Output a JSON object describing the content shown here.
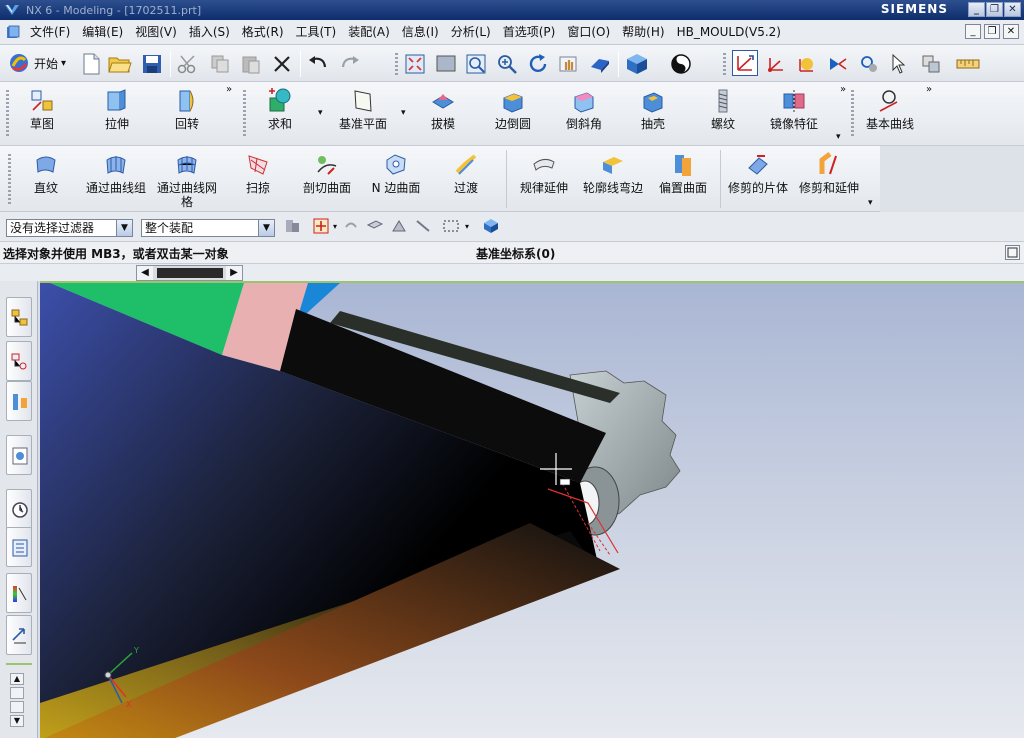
{
  "window": {
    "title": "NX 6 - Modeling - [1702511.prt]",
    "brand": "SIEMENS",
    "controls": [
      "_",
      "❐",
      "✕"
    ]
  },
  "menubar": {
    "items": [
      "文件(F)",
      "编辑(E)",
      "视图(V)",
      "插入(S)",
      "格式(R)",
      "工具(T)",
      "装配(A)",
      "信息(I)",
      "分析(L)",
      "首选项(P)",
      "窗口(O)",
      "帮助(H)",
      "HB_MOULD(V5.2)"
    ],
    "mdi_controls": [
      "_",
      "❐",
      "✕"
    ]
  },
  "standard_toolbar": {
    "start_label": "开始",
    "start_arrow": "▾"
  },
  "feature_toolbar": {
    "items": [
      "草图",
      "拉伸",
      "回转",
      "求和",
      "基准平面",
      "拔模",
      "边倒圆",
      "倒斜角",
      "抽壳",
      "螺纹",
      "镜像特征",
      "基本曲线"
    ],
    "overflow": "»"
  },
  "surface_toolbar": {
    "items": [
      "直纹",
      "通过曲线组",
      "通过曲线网格",
      "扫掠",
      "剖切曲面",
      "N 边曲面",
      "过渡",
      "规律延伸",
      "轮廓线弯边",
      "偏置曲面",
      "修剪的片体",
      "修剪和延伸"
    ]
  },
  "selection_bar": {
    "filter_value": "没有选择过滤器",
    "scope_value": "整个装配"
  },
  "status": {
    "cue": "选择对象并使用 MB3，或者双击某一对象",
    "status_text": "基准坐标系(0)"
  },
  "triad": {
    "x_label": "X",
    "y_label": "Y"
  },
  "colors": {
    "title_bar": "#0d2d6b",
    "viewport_top": "#a9b6d4",
    "viewport_bottom": "#e6e9ef",
    "model_gray": "#9aa4a7",
    "accent_red": "#e03030"
  }
}
